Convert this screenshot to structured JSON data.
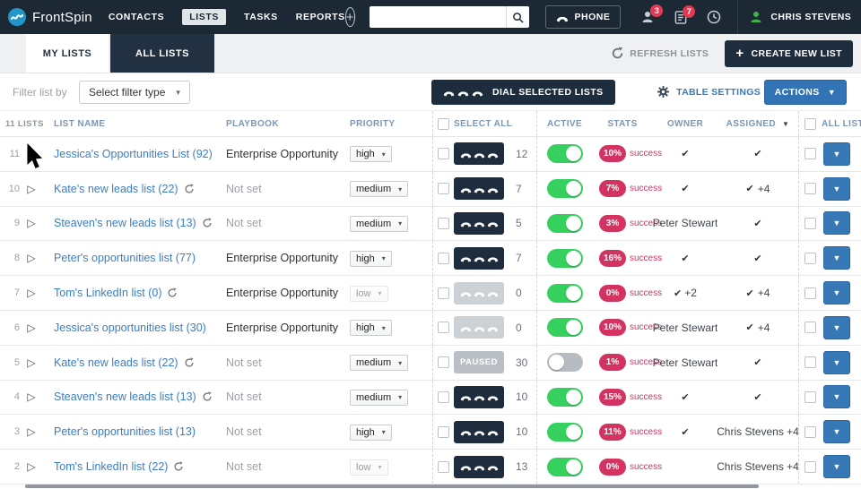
{
  "colors": {
    "topbar_bg": "#1c2834",
    "tab_active_bg": "#223141",
    "accent_blue": "#3273b5",
    "link_blue": "#3b7dc4",
    "success_green": "#35d05e",
    "stats_red": "#d23360",
    "navy_button": "#1e2d3d",
    "badge_red": "#e13a52",
    "avatar_green": "#3cb54b"
  },
  "topbar": {
    "brand": "FrontSpin",
    "nav": [
      "CONTACTS",
      "LISTS",
      "TASKS",
      "REPORTS"
    ],
    "search": {
      "value": "",
      "placeholder": ""
    },
    "phone_label": "PHONE",
    "badge_contacts": "3",
    "badge_tasks": "7",
    "user_name": "CHRIS STEVENS"
  },
  "tabs": {
    "my_lists": "MY LISTS",
    "all_lists": "ALL LISTS",
    "refresh_lists": "REFRESH LISTS",
    "create_plus": "+",
    "create_new_list": "CREATE NEW LIST"
  },
  "toolbar": {
    "filter_label": "Filter list by",
    "filter_value": "Select filter type",
    "dial_selected": "DIAL SELECTED LISTS",
    "table_settings": "TABLE SETTINGS",
    "actions": "ACTIONS"
  },
  "table": {
    "count_label": "11 LISTS",
    "headers": {
      "list_name": "LIST NAME",
      "playbook": "PLAYBOOK",
      "priority": "PRIORITY",
      "select_all": "SELECT ALL",
      "active": "ACTIVE",
      "stats": "STATS",
      "owner": "OWNER",
      "assigned": "ASSIGNED",
      "all_lists": "ALL LIST"
    },
    "stats_suffix": "success",
    "rows": [
      {
        "num": "11",
        "name": "Jessica's Opportunities List (92)",
        "refresh": false,
        "playbook": "Enterprise Opportunity",
        "playbook_set": true,
        "priority": "high",
        "priority_disabled": false,
        "dial": "active",
        "dial_label": "",
        "count": "12",
        "toggle_on": true,
        "stats": "10%",
        "owner_check": true,
        "owner_text": "",
        "assigned_check": true,
        "assigned_text": ""
      },
      {
        "num": "10",
        "name": "Kate's new leads list (22)",
        "refresh": true,
        "playbook": "Not set",
        "playbook_set": false,
        "priority": "medium",
        "priority_disabled": false,
        "dial": "active",
        "dial_label": "",
        "count": "7",
        "toggle_on": true,
        "stats": "7%",
        "owner_check": true,
        "owner_text": "",
        "assigned_check": true,
        "assigned_text": "+4"
      },
      {
        "num": "9",
        "name": "Steaven's new leads list (13)",
        "refresh": true,
        "playbook": "Not set",
        "playbook_set": false,
        "priority": "medium",
        "priority_disabled": false,
        "dial": "active",
        "dial_label": "",
        "count": "5",
        "toggle_on": true,
        "stats": "3%",
        "owner_check": false,
        "owner_text": "Peter Stewart",
        "assigned_check": true,
        "assigned_text": ""
      },
      {
        "num": "8",
        "name": "Peter's opportunities list (77)",
        "refresh": false,
        "playbook": "Enterprise Opportunity",
        "playbook_set": true,
        "priority": "high",
        "priority_disabled": false,
        "dial": "active",
        "dial_label": "",
        "count": "7",
        "toggle_on": true,
        "stats": "16%",
        "owner_check": true,
        "owner_text": "",
        "assigned_check": true,
        "assigned_text": ""
      },
      {
        "num": "7",
        "name": "Tom's LinkedIn list (0)",
        "refresh": true,
        "playbook": "Enterprise Opportunity",
        "playbook_set": true,
        "priority": "low",
        "priority_disabled": true,
        "dial": "disabled",
        "dial_label": "",
        "count": "0",
        "toggle_on": true,
        "stats": "0%",
        "owner_check": true,
        "owner_text": "+2",
        "assigned_check": true,
        "assigned_text": "+4"
      },
      {
        "num": "6",
        "name": "Jessica's opportunities list (30)",
        "refresh": false,
        "playbook": "Enterprise Opportunity",
        "playbook_set": true,
        "priority": "high",
        "priority_disabled": false,
        "dial": "disabled",
        "dial_label": "",
        "count": "0",
        "toggle_on": true,
        "stats": "10%",
        "owner_check": false,
        "owner_text": "Peter Stewart",
        "assigned_check": true,
        "assigned_text": "+4"
      },
      {
        "num": "5",
        "name": "Kate's new leads list (22)",
        "refresh": true,
        "playbook": "Not set",
        "playbook_set": false,
        "priority": "medium",
        "priority_disabled": false,
        "dial": "paused",
        "dial_label": "PAUSED",
        "count": "30",
        "toggle_on": false,
        "stats": "1%",
        "owner_check": false,
        "owner_text": "Peter Stewart",
        "assigned_check": true,
        "assigned_text": ""
      },
      {
        "num": "4",
        "name": "Steaven's new leads list (13)",
        "refresh": true,
        "playbook": "Not set",
        "playbook_set": false,
        "priority": "medium",
        "priority_disabled": false,
        "dial": "active",
        "dial_label": "",
        "count": "10",
        "toggle_on": true,
        "stats": "15%",
        "owner_check": true,
        "owner_text": "",
        "assigned_check": true,
        "assigned_text": ""
      },
      {
        "num": "3",
        "name": "Peter's opportunities list (13)",
        "refresh": false,
        "playbook": "Not set",
        "playbook_set": false,
        "priority": "high",
        "priority_disabled": false,
        "dial": "active",
        "dial_label": "",
        "count": "10",
        "toggle_on": true,
        "stats": "11%",
        "owner_check": true,
        "owner_text": "",
        "assigned_check": false,
        "assigned_text": "Chris Stevens +4"
      },
      {
        "num": "2",
        "name": "Tom's LinkedIn list (22)",
        "refresh": true,
        "playbook": "Not set",
        "playbook_set": false,
        "priority": "low",
        "priority_disabled": true,
        "dial": "active",
        "dial_label": "",
        "count": "13",
        "toggle_on": true,
        "stats": "0%",
        "owner_check": false,
        "owner_text": "",
        "assigned_check": false,
        "assigned_text": "Chris Stevens +4"
      }
    ]
  }
}
